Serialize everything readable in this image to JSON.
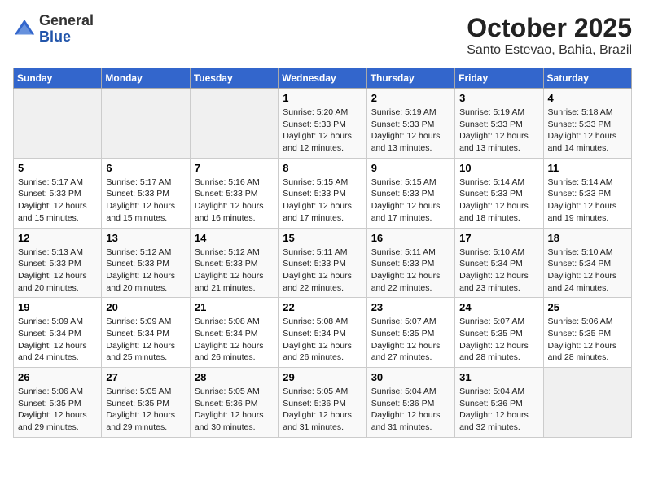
{
  "header": {
    "logo_general": "General",
    "logo_blue": "Blue",
    "month_title": "October 2025",
    "location": "Santo Estevao, Bahia, Brazil"
  },
  "days_of_week": [
    "Sunday",
    "Monday",
    "Tuesday",
    "Wednesday",
    "Thursday",
    "Friday",
    "Saturday"
  ],
  "weeks": [
    [
      {
        "day": "",
        "info": ""
      },
      {
        "day": "",
        "info": ""
      },
      {
        "day": "",
        "info": ""
      },
      {
        "day": "1",
        "info": "Sunrise: 5:20 AM\nSunset: 5:33 PM\nDaylight: 12 hours\nand 12 minutes."
      },
      {
        "day": "2",
        "info": "Sunrise: 5:19 AM\nSunset: 5:33 PM\nDaylight: 12 hours\nand 13 minutes."
      },
      {
        "day": "3",
        "info": "Sunrise: 5:19 AM\nSunset: 5:33 PM\nDaylight: 12 hours\nand 13 minutes."
      },
      {
        "day": "4",
        "info": "Sunrise: 5:18 AM\nSunset: 5:33 PM\nDaylight: 12 hours\nand 14 minutes."
      }
    ],
    [
      {
        "day": "5",
        "info": "Sunrise: 5:17 AM\nSunset: 5:33 PM\nDaylight: 12 hours\nand 15 minutes."
      },
      {
        "day": "6",
        "info": "Sunrise: 5:17 AM\nSunset: 5:33 PM\nDaylight: 12 hours\nand 15 minutes."
      },
      {
        "day": "7",
        "info": "Sunrise: 5:16 AM\nSunset: 5:33 PM\nDaylight: 12 hours\nand 16 minutes."
      },
      {
        "day": "8",
        "info": "Sunrise: 5:15 AM\nSunset: 5:33 PM\nDaylight: 12 hours\nand 17 minutes."
      },
      {
        "day": "9",
        "info": "Sunrise: 5:15 AM\nSunset: 5:33 PM\nDaylight: 12 hours\nand 17 minutes."
      },
      {
        "day": "10",
        "info": "Sunrise: 5:14 AM\nSunset: 5:33 PM\nDaylight: 12 hours\nand 18 minutes."
      },
      {
        "day": "11",
        "info": "Sunrise: 5:14 AM\nSunset: 5:33 PM\nDaylight: 12 hours\nand 19 minutes."
      }
    ],
    [
      {
        "day": "12",
        "info": "Sunrise: 5:13 AM\nSunset: 5:33 PM\nDaylight: 12 hours\nand 20 minutes."
      },
      {
        "day": "13",
        "info": "Sunrise: 5:12 AM\nSunset: 5:33 PM\nDaylight: 12 hours\nand 20 minutes."
      },
      {
        "day": "14",
        "info": "Sunrise: 5:12 AM\nSunset: 5:33 PM\nDaylight: 12 hours\nand 21 minutes."
      },
      {
        "day": "15",
        "info": "Sunrise: 5:11 AM\nSunset: 5:33 PM\nDaylight: 12 hours\nand 22 minutes."
      },
      {
        "day": "16",
        "info": "Sunrise: 5:11 AM\nSunset: 5:33 PM\nDaylight: 12 hours\nand 22 minutes."
      },
      {
        "day": "17",
        "info": "Sunrise: 5:10 AM\nSunset: 5:34 PM\nDaylight: 12 hours\nand 23 minutes."
      },
      {
        "day": "18",
        "info": "Sunrise: 5:10 AM\nSunset: 5:34 PM\nDaylight: 12 hours\nand 24 minutes."
      }
    ],
    [
      {
        "day": "19",
        "info": "Sunrise: 5:09 AM\nSunset: 5:34 PM\nDaylight: 12 hours\nand 24 minutes."
      },
      {
        "day": "20",
        "info": "Sunrise: 5:09 AM\nSunset: 5:34 PM\nDaylight: 12 hours\nand 25 minutes."
      },
      {
        "day": "21",
        "info": "Sunrise: 5:08 AM\nSunset: 5:34 PM\nDaylight: 12 hours\nand 26 minutes."
      },
      {
        "day": "22",
        "info": "Sunrise: 5:08 AM\nSunset: 5:34 PM\nDaylight: 12 hours\nand 26 minutes."
      },
      {
        "day": "23",
        "info": "Sunrise: 5:07 AM\nSunset: 5:35 PM\nDaylight: 12 hours\nand 27 minutes."
      },
      {
        "day": "24",
        "info": "Sunrise: 5:07 AM\nSunset: 5:35 PM\nDaylight: 12 hours\nand 28 minutes."
      },
      {
        "day": "25",
        "info": "Sunrise: 5:06 AM\nSunset: 5:35 PM\nDaylight: 12 hours\nand 28 minutes."
      }
    ],
    [
      {
        "day": "26",
        "info": "Sunrise: 5:06 AM\nSunset: 5:35 PM\nDaylight: 12 hours\nand 29 minutes."
      },
      {
        "day": "27",
        "info": "Sunrise: 5:05 AM\nSunset: 5:35 PM\nDaylight: 12 hours\nand 29 minutes."
      },
      {
        "day": "28",
        "info": "Sunrise: 5:05 AM\nSunset: 5:36 PM\nDaylight: 12 hours\nand 30 minutes."
      },
      {
        "day": "29",
        "info": "Sunrise: 5:05 AM\nSunset: 5:36 PM\nDaylight: 12 hours\nand 31 minutes."
      },
      {
        "day": "30",
        "info": "Sunrise: 5:04 AM\nSunset: 5:36 PM\nDaylight: 12 hours\nand 31 minutes."
      },
      {
        "day": "31",
        "info": "Sunrise: 5:04 AM\nSunset: 5:36 PM\nDaylight: 12 hours\nand 32 minutes."
      },
      {
        "day": "",
        "info": ""
      }
    ]
  ]
}
